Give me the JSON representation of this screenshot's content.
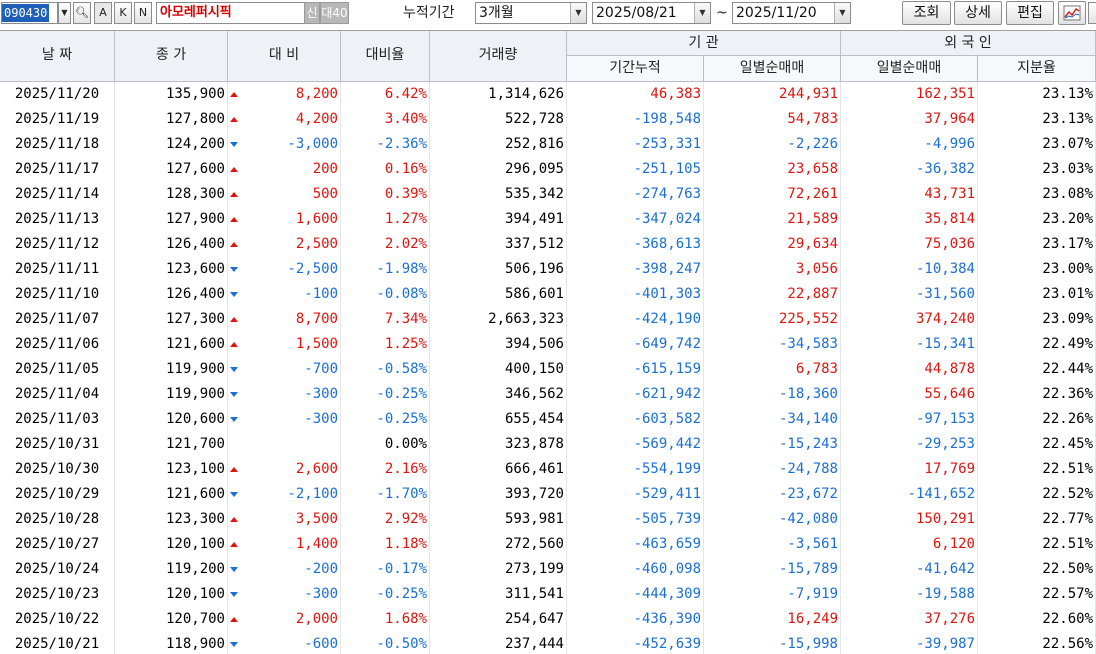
{
  "toolbar": {
    "stock_code": "090430",
    "btn_a": "A",
    "btn_k": "K",
    "btn_n": "N",
    "stock_name": "아모레퍼시픽",
    "badge_new": "신",
    "badge_40": "대40",
    "period_label": "누적기간",
    "period_value": "3개월",
    "start_date": "2025/08/21",
    "tilde": "~",
    "end_date": "2025/11/20",
    "btn_query": "조회",
    "btn_detail": "상세",
    "btn_edit": "편집"
  },
  "headers": {
    "date": "날 짜",
    "close": "종 가",
    "change": "대 비",
    "change_rate": "대비율",
    "volume": "거래량",
    "institution": "기 관",
    "inst_cum": "기간누적",
    "inst_daily": "일별순매매",
    "foreign": "외 국 인",
    "foreign_daily": "일별순매매",
    "foreign_share": "지분율"
  },
  "rows": [
    {
      "date": "2025/11/20",
      "close": "135,900",
      "dir": "up",
      "change": "8,200",
      "rate": "6.42%",
      "volume": "1,314,626",
      "inst_cum": "46,383",
      "inst_daily": "244,931",
      "for_daily": "162,351",
      "share": "23.13%"
    },
    {
      "date": "2025/11/19",
      "close": "127,800",
      "dir": "up",
      "change": "4,200",
      "rate": "3.40%",
      "volume": "522,728",
      "inst_cum": "-198,548",
      "inst_daily": "54,783",
      "for_daily": "37,964",
      "share": "23.13%"
    },
    {
      "date": "2025/11/18",
      "close": "124,200",
      "dir": "dn",
      "change": "-3,000",
      "rate": "-2.36%",
      "volume": "252,816",
      "inst_cum": "-253,331",
      "inst_daily": "-2,226",
      "for_daily": "-4,996",
      "share": "23.07%"
    },
    {
      "date": "2025/11/17",
      "close": "127,600",
      "dir": "up",
      "change": "200",
      "rate": "0.16%",
      "volume": "296,095",
      "inst_cum": "-251,105",
      "inst_daily": "23,658",
      "for_daily": "-36,382",
      "share": "23.03%"
    },
    {
      "date": "2025/11/14",
      "close": "128,300",
      "dir": "up",
      "change": "500",
      "rate": "0.39%",
      "volume": "535,342",
      "inst_cum": "-274,763",
      "inst_daily": "72,261",
      "for_daily": "43,731",
      "share": "23.08%"
    },
    {
      "date": "2025/11/13",
      "close": "127,900",
      "dir": "up",
      "change": "1,600",
      "rate": "1.27%",
      "volume": "394,491",
      "inst_cum": "-347,024",
      "inst_daily": "21,589",
      "for_daily": "35,814",
      "share": "23.20%"
    },
    {
      "date": "2025/11/12",
      "close": "126,400",
      "dir": "up",
      "change": "2,500",
      "rate": "2.02%",
      "volume": "337,512",
      "inst_cum": "-368,613",
      "inst_daily": "29,634",
      "for_daily": "75,036",
      "share": "23.17%"
    },
    {
      "date": "2025/11/11",
      "close": "123,600",
      "dir": "dn",
      "change": "-2,500",
      "rate": "-1.98%",
      "volume": "506,196",
      "inst_cum": "-398,247",
      "inst_daily": "3,056",
      "for_daily": "-10,384",
      "share": "23.00%"
    },
    {
      "date": "2025/11/10",
      "close": "126,400",
      "dir": "dn",
      "change": "-100",
      "rate": "-0.08%",
      "volume": "586,601",
      "inst_cum": "-401,303",
      "inst_daily": "22,887",
      "for_daily": "-31,560",
      "share": "23.01%"
    },
    {
      "date": "2025/11/07",
      "close": "127,300",
      "dir": "up",
      "change": "8,700",
      "rate": "7.34%",
      "volume": "2,663,323",
      "inst_cum": "-424,190",
      "inst_daily": "225,552",
      "for_daily": "374,240",
      "share": "23.09%"
    },
    {
      "date": "2025/11/06",
      "close": "121,600",
      "dir": "up",
      "change": "1,500",
      "rate": "1.25%",
      "volume": "394,506",
      "inst_cum": "-649,742",
      "inst_daily": "-34,583",
      "for_daily": "-15,341",
      "share": "22.49%"
    },
    {
      "date": "2025/11/05",
      "close": "119,900",
      "dir": "dn",
      "change": "-700",
      "rate": "-0.58%",
      "volume": "400,150",
      "inst_cum": "-615,159",
      "inst_daily": "6,783",
      "for_daily": "44,878",
      "share": "22.44%"
    },
    {
      "date": "2025/11/04",
      "close": "119,900",
      "dir": "dn",
      "change": "-300",
      "rate": "-0.25%",
      "volume": "346,562",
      "inst_cum": "-621,942",
      "inst_daily": "-18,360",
      "for_daily": "55,646",
      "share": "22.36%"
    },
    {
      "date": "2025/11/03",
      "close": "120,600",
      "dir": "dn",
      "change": "-300",
      "rate": "-0.25%",
      "volume": "655,454",
      "inst_cum": "-603,582",
      "inst_daily": "-34,140",
      "for_daily": "-97,153",
      "share": "22.26%"
    },
    {
      "date": "2025/10/31",
      "close": "121,700",
      "dir": "flat",
      "change": "",
      "rate": "0.00%",
      "volume": "323,878",
      "inst_cum": "-569,442",
      "inst_daily": "-15,243",
      "for_daily": "-29,253",
      "share": "22.45%"
    },
    {
      "date": "2025/10/30",
      "close": "123,100",
      "dir": "up",
      "change": "2,600",
      "rate": "2.16%",
      "volume": "666,461",
      "inst_cum": "-554,199",
      "inst_daily": "-24,788",
      "for_daily": "17,769",
      "share": "22.51%"
    },
    {
      "date": "2025/10/29",
      "close": "121,600",
      "dir": "dn",
      "change": "-2,100",
      "rate": "-1.70%",
      "volume": "393,720",
      "inst_cum": "-529,411",
      "inst_daily": "-23,672",
      "for_daily": "-141,652",
      "share": "22.52%"
    },
    {
      "date": "2025/10/28",
      "close": "123,300",
      "dir": "up",
      "change": "3,500",
      "rate": "2.92%",
      "volume": "593,981",
      "inst_cum": "-505,739",
      "inst_daily": "-42,080",
      "for_daily": "150,291",
      "share": "22.77%"
    },
    {
      "date": "2025/10/27",
      "close": "120,100",
      "dir": "up",
      "change": "1,400",
      "rate": "1.18%",
      "volume": "272,560",
      "inst_cum": "-463,659",
      "inst_daily": "-3,561",
      "for_daily": "6,120",
      "share": "22.51%"
    },
    {
      "date": "2025/10/24",
      "close": "119,200",
      "dir": "dn",
      "change": "-200",
      "rate": "-0.17%",
      "volume": "273,199",
      "inst_cum": "-460,098",
      "inst_daily": "-15,789",
      "for_daily": "-41,642",
      "share": "22.50%"
    },
    {
      "date": "2025/10/23",
      "close": "120,100",
      "dir": "dn",
      "change": "-300",
      "rate": "-0.25%",
      "volume": "311,541",
      "inst_cum": "-444,309",
      "inst_daily": "-7,919",
      "for_daily": "-19,588",
      "share": "22.57%"
    },
    {
      "date": "2025/10/22",
      "close": "120,700",
      "dir": "up",
      "change": "2,000",
      "rate": "1.68%",
      "volume": "254,647",
      "inst_cum": "-436,390",
      "inst_daily": "16,249",
      "for_daily": "37,276",
      "share": "22.60%"
    },
    {
      "date": "2025/10/21",
      "close": "118,900",
      "dir": "dn",
      "change": "-600",
      "rate": "-0.50%",
      "volume": "237,444",
      "inst_cum": "-452,639",
      "inst_daily": "-15,998",
      "for_daily": "-39,987",
      "share": "22.56%"
    }
  ],
  "colors": {
    "up": "#e0140f",
    "down": "#1a6fd6",
    "header_bg": "#eef1f6",
    "code_highlight": "#1f5fb8",
    "stock_name": "#d40000"
  }
}
